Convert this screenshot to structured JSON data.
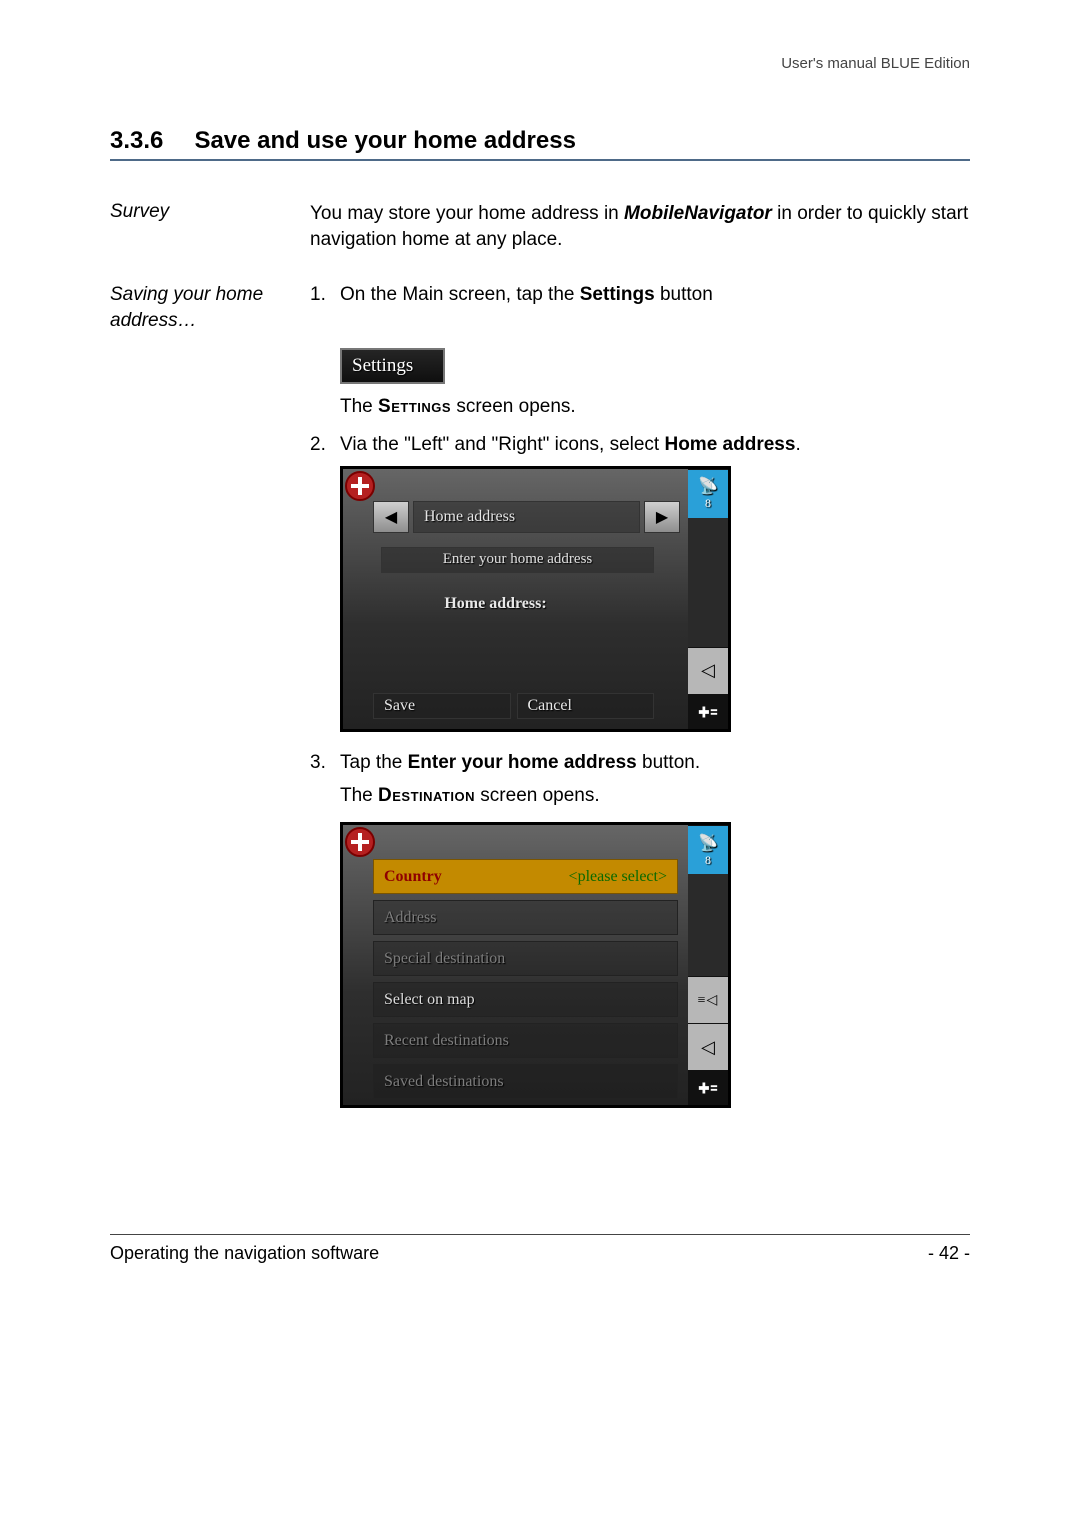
{
  "header": {
    "running": "User's manual BLUE Edition"
  },
  "section": {
    "number": "3.3.6",
    "title": "Save and use your home address"
  },
  "survey": {
    "label": "Survey",
    "pre": "You may store your home address in ",
    "app": "MobileNavigator",
    "post": " in order to quickly start navigation home at any place."
  },
  "saving": {
    "label": "Saving your home address…",
    "step1": {
      "n": "1.",
      "pre": "On the Main screen, tap the ",
      "bold": "Settings",
      "post": " button"
    },
    "settings_btn": "Settings",
    "settings_opens": {
      "pre": "The ",
      "sc": "Settings",
      "post": " screen opens."
    },
    "step2": {
      "n": "2.",
      "pre": "Via the \"Left\" and \"Right\" icons, select ",
      "bold": "Home address",
      "post": "."
    },
    "step3": {
      "n": "3.",
      "pre": "Tap the ",
      "bold": "Enter your home address",
      "post": " button."
    },
    "dest_opens": {
      "pre": "The ",
      "sc": "Destination",
      "post": " screen opens."
    }
  },
  "shot1": {
    "gps_sat": "8",
    "pager_label": "Home address",
    "enter": "Enter your home address",
    "home_label": "Home address:",
    "save": "Save",
    "cancel": "Cancel"
  },
  "shot2": {
    "gps_sat": "8",
    "country_k": "Country",
    "country_v": "<please select>",
    "address": "Address",
    "special": "Special destination",
    "selectmap": "Select on map",
    "recent": "Recent destinations",
    "saved": "Saved destinations"
  },
  "footer": {
    "left": "Operating the navigation software",
    "right": "- 42 -"
  }
}
